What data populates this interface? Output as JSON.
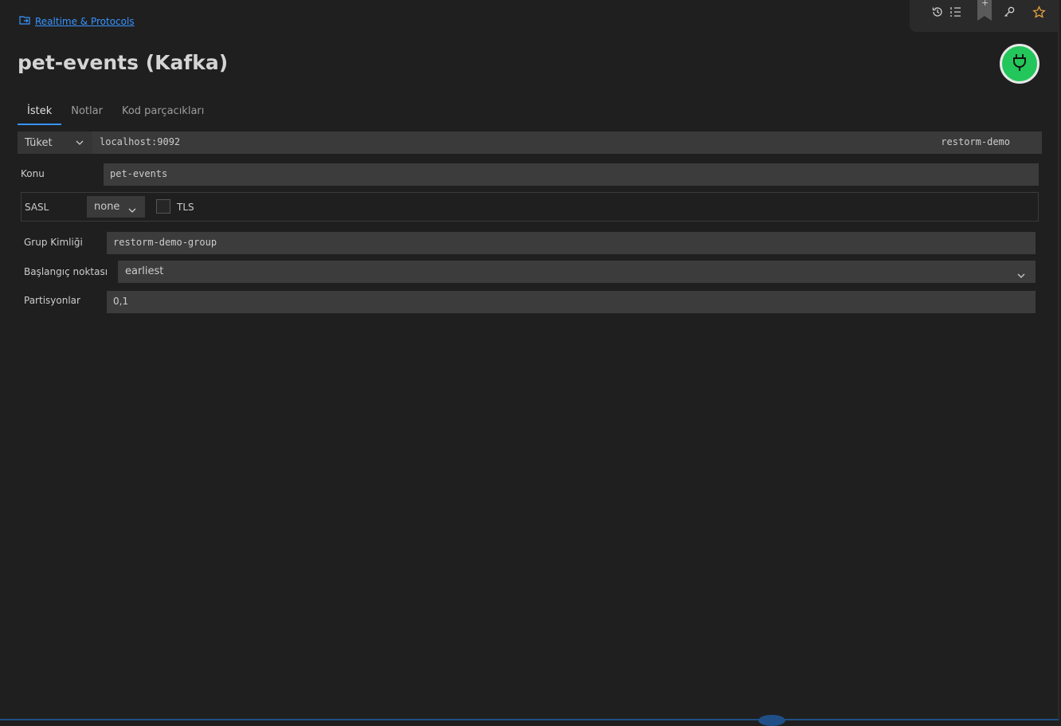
{
  "breadcrumb": {
    "label": "Realtime & Protocols",
    "icon": "folder-link-icon"
  },
  "toolbar": {
    "icons": [
      "history-icon",
      "list-icon",
      "bookmark-add-icon",
      "key-icon",
      "star-icon"
    ],
    "bookmark_plus": "+",
    "star_color": "#e8a33d"
  },
  "page": {
    "title": "pet-events (Kafka)"
  },
  "connect": {
    "icon": "plug-icon",
    "color": "#23c65a"
  },
  "tabs": [
    {
      "label": "İstek",
      "active": true
    },
    {
      "label": "Notlar",
      "active": false
    },
    {
      "label": "Kod parçacıkları",
      "active": false
    }
  ],
  "request": {
    "method": "Tüket",
    "url": "localhost:9092",
    "environment": "restorm-demo"
  },
  "form": {
    "topic_label": "Konu",
    "topic_value": "pet-events",
    "sasl_label": "SASL",
    "sasl_value": "none",
    "tls_label": "TLS",
    "tls_checked": false,
    "group_label": "Grup Kimliği",
    "group_value": "restorm-demo-group",
    "offset_label": "Başlangıç noktası",
    "offset_value": "earliest",
    "partitions_label": "Partisyonlar",
    "partitions_value": "0,1"
  },
  "colors": {
    "accent": "#3794ff",
    "background": "#1f1f1f"
  }
}
